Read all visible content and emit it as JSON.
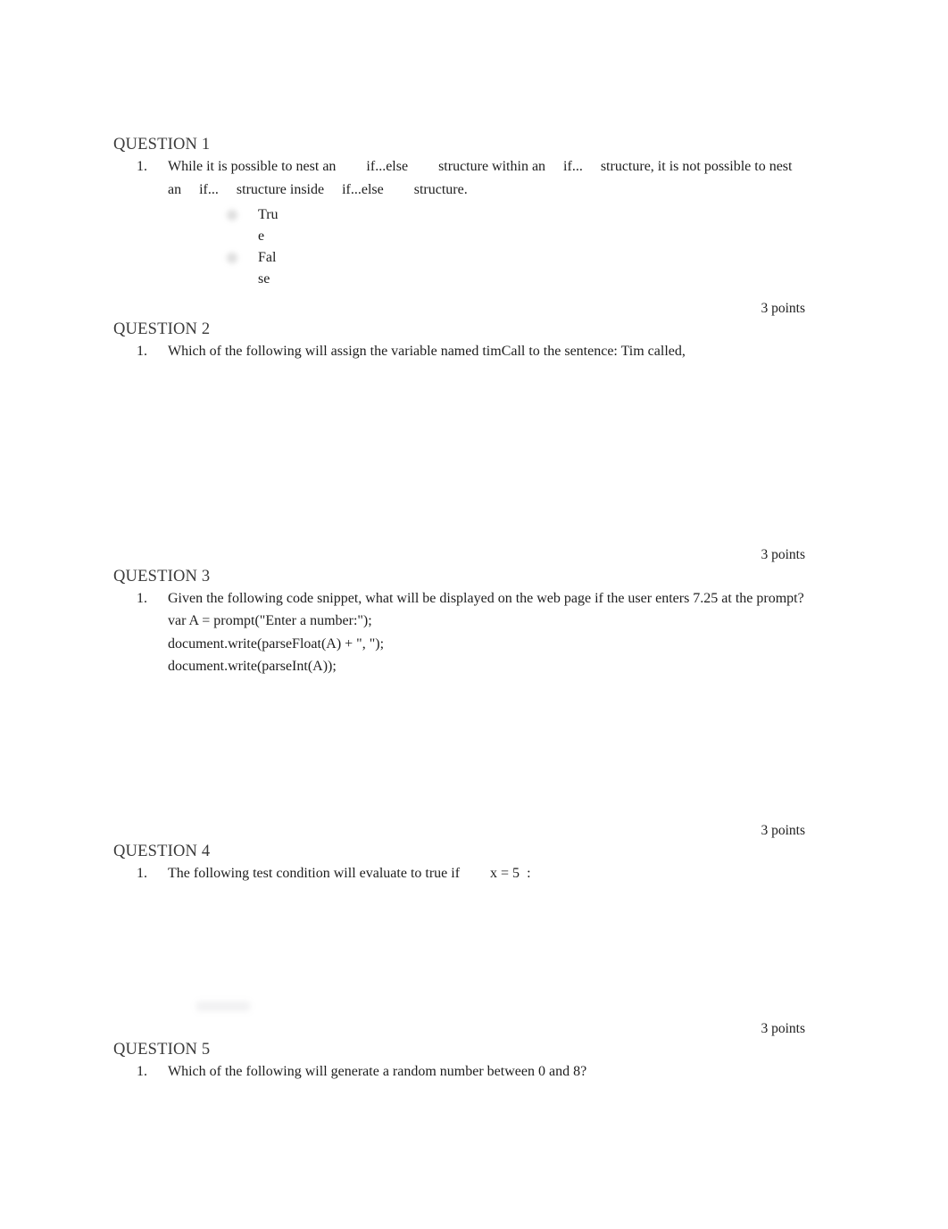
{
  "document": {
    "type": "quiz-page",
    "page_background": "#ffffff",
    "text_color": "#1d1d1d",
    "heading_color": "#3a3a3a"
  },
  "questions": [
    {
      "heading": "QUESTION 1",
      "number_marker": "1.",
      "text_segments": [
        "While it is possible to nest an",
        "if...else",
        "structure within an",
        "if...",
        "structure, it is not possible to nest an",
        "if...",
        "structure inside",
        "if...else",
        "structure."
      ],
      "full_text": "While it is possible to nest an  if...else  structure within an  if...  structure, it is not possible to nest an  if...  structure inside  if...else  structure.",
      "options": [
        {
          "label": "True",
          "selected": false,
          "style": "blurred-radio"
        },
        {
          "label": "False",
          "selected": false,
          "style": "blurred-radio"
        }
      ],
      "points": "3 points"
    },
    {
      "heading": "QUESTION 2",
      "number_marker": "1.",
      "full_text": "Which of the following will assign the variable named timCall to the sentence: Tim called,",
      "options": [],
      "points": "3 points"
    },
    {
      "heading": "QUESTION 3",
      "number_marker": "1.",
      "full_text": "Given the following code snippet, what will be displayed on the web page if the user enters 7.25 at the prompt?",
      "code_lines": [
        "var A = prompt(\"Enter a number:\");",
        "document.write(parseFloat(A) + \", \");",
        "document.write(parseInt(A));"
      ],
      "options": [],
      "points": "3 points"
    },
    {
      "heading": "QUESTION 4",
      "number_marker": "1.",
      "text_before": "The following test condition will evaluate to true if",
      "code_inline": "x = 5",
      "text_after": ":",
      "full_text": "The following test condition will evaluate to true if  x = 5  :",
      "options": [],
      "points": "3 points"
    },
    {
      "heading": "QUESTION 5",
      "number_marker": "1.",
      "full_text": "Which of the following will generate a random number between 0 and 8?",
      "options": [],
      "points": ""
    }
  ]
}
